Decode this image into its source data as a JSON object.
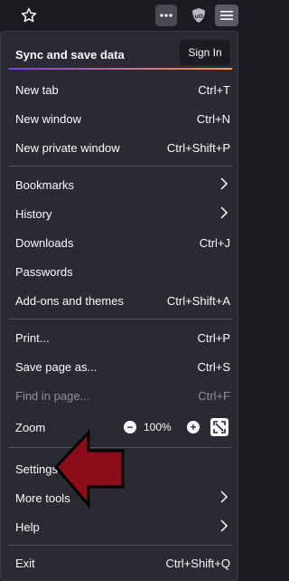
{
  "menu": {
    "sync_label": "Sync and save data",
    "sign_in": "Sign In",
    "items": [
      {
        "label": "New tab",
        "shortcut": "Ctrl+T"
      },
      {
        "label": "New window",
        "shortcut": "Ctrl+N"
      },
      {
        "label": "New private window",
        "shortcut": "Ctrl+Shift+P"
      },
      {
        "label": "Bookmarks",
        "shortcut": ""
      },
      {
        "label": "History",
        "shortcut": ""
      },
      {
        "label": "Downloads",
        "shortcut": "Ctrl+J"
      },
      {
        "label": "Passwords",
        "shortcut": ""
      },
      {
        "label": "Add-ons and themes",
        "shortcut": "Ctrl+Shift+A"
      },
      {
        "label": "Print...",
        "shortcut": "Ctrl+P"
      },
      {
        "label": "Save page as...",
        "shortcut": "Ctrl+S"
      },
      {
        "label": "Find in page...",
        "shortcut": "Ctrl+F"
      },
      {
        "label": "Zoom",
        "shortcut": ""
      },
      {
        "label": "Settings",
        "shortcut": ""
      },
      {
        "label": "More tools",
        "shortcut": ""
      },
      {
        "label": "Help",
        "shortcut": ""
      },
      {
        "label": "Exit",
        "shortcut": "Ctrl+Shift+Q"
      }
    ],
    "zoom": {
      "minus": "−",
      "value": "100%",
      "plus": "+"
    }
  },
  "colors": {
    "panel_bg": "#2b2a33",
    "toolbar_bg": "#1c1b22",
    "accent_gradient_start": "#7542e5",
    "accent_gradient_end": "#ff9640",
    "annotation_arrow": "#8b0c1a"
  }
}
